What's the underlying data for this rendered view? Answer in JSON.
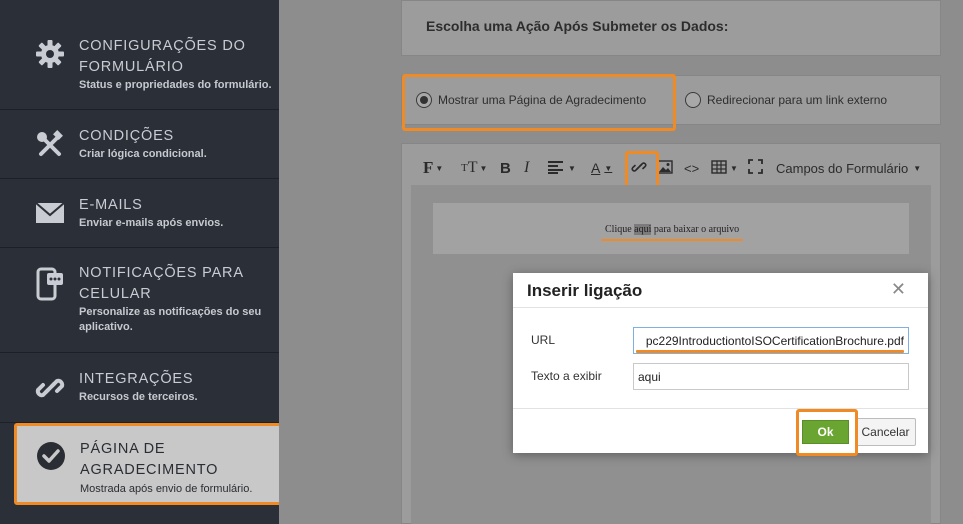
{
  "sidebar": {
    "items": [
      {
        "title_line1": "CONFIGURAÇÕES DO",
        "title_line2": "FORMULÁRIO",
        "subtitle": "Status e propriedades do formulário.",
        "icon": "gear-icon"
      },
      {
        "title_line1": "CONDIÇÕES",
        "subtitle": "Criar lógica condicional.",
        "icon": "tools-icon"
      },
      {
        "title_line1": "E-MAILS",
        "subtitle": "Enviar e-mails após envios.",
        "icon": "envelope-icon"
      },
      {
        "title_line1": "NOTIFICAÇÕES PARA",
        "title_line2": "CELULAR",
        "subtitle_line1": "Personalize as notificações do seu",
        "subtitle_line2": "aplicativo.",
        "icon": "mobile-notification-icon"
      },
      {
        "title_line1": "INTEGRAÇÕES",
        "subtitle": "Recursos de terceiros.",
        "icon": "link-icon"
      },
      {
        "title_line1": "PÁGINA DE",
        "title_line2": "AGRADECIMENTO",
        "subtitle": "Mostrada após envio de formulário.",
        "icon": "check-circle-icon"
      }
    ]
  },
  "main": {
    "heading": "Escolha uma Ação Após Submeter os Dados:",
    "options": [
      {
        "label": "Mostrar uma Página de Agradecimento",
        "selected": true
      },
      {
        "label": "Redirecionar para um link externo",
        "selected": false
      }
    ],
    "toolbar": {
      "font_label": "F",
      "size_label": "T",
      "bold_label": "B",
      "italic_label": "I",
      "color_label": "A",
      "code_label": "<>",
      "fields_label": "Campos do Formulário"
    },
    "editor": {
      "text_before": "Clique ",
      "text_link": "aqui",
      "text_after": " para baixar o arquivo"
    }
  },
  "dialog": {
    "title": "Inserir ligação",
    "close_symbol": "✕",
    "url_label": "URL",
    "url_value": "pc229IntroductiontoISOCertificationBrochure.pdf",
    "text_label": "Texto a exibir",
    "text_value": "aqui",
    "ok_label": "Ok",
    "cancel_label": "Cancelar"
  },
  "colors": {
    "highlight": "#f08a24",
    "ok_button": "#6aa531",
    "sidebar_bg": "#2b2f37"
  }
}
